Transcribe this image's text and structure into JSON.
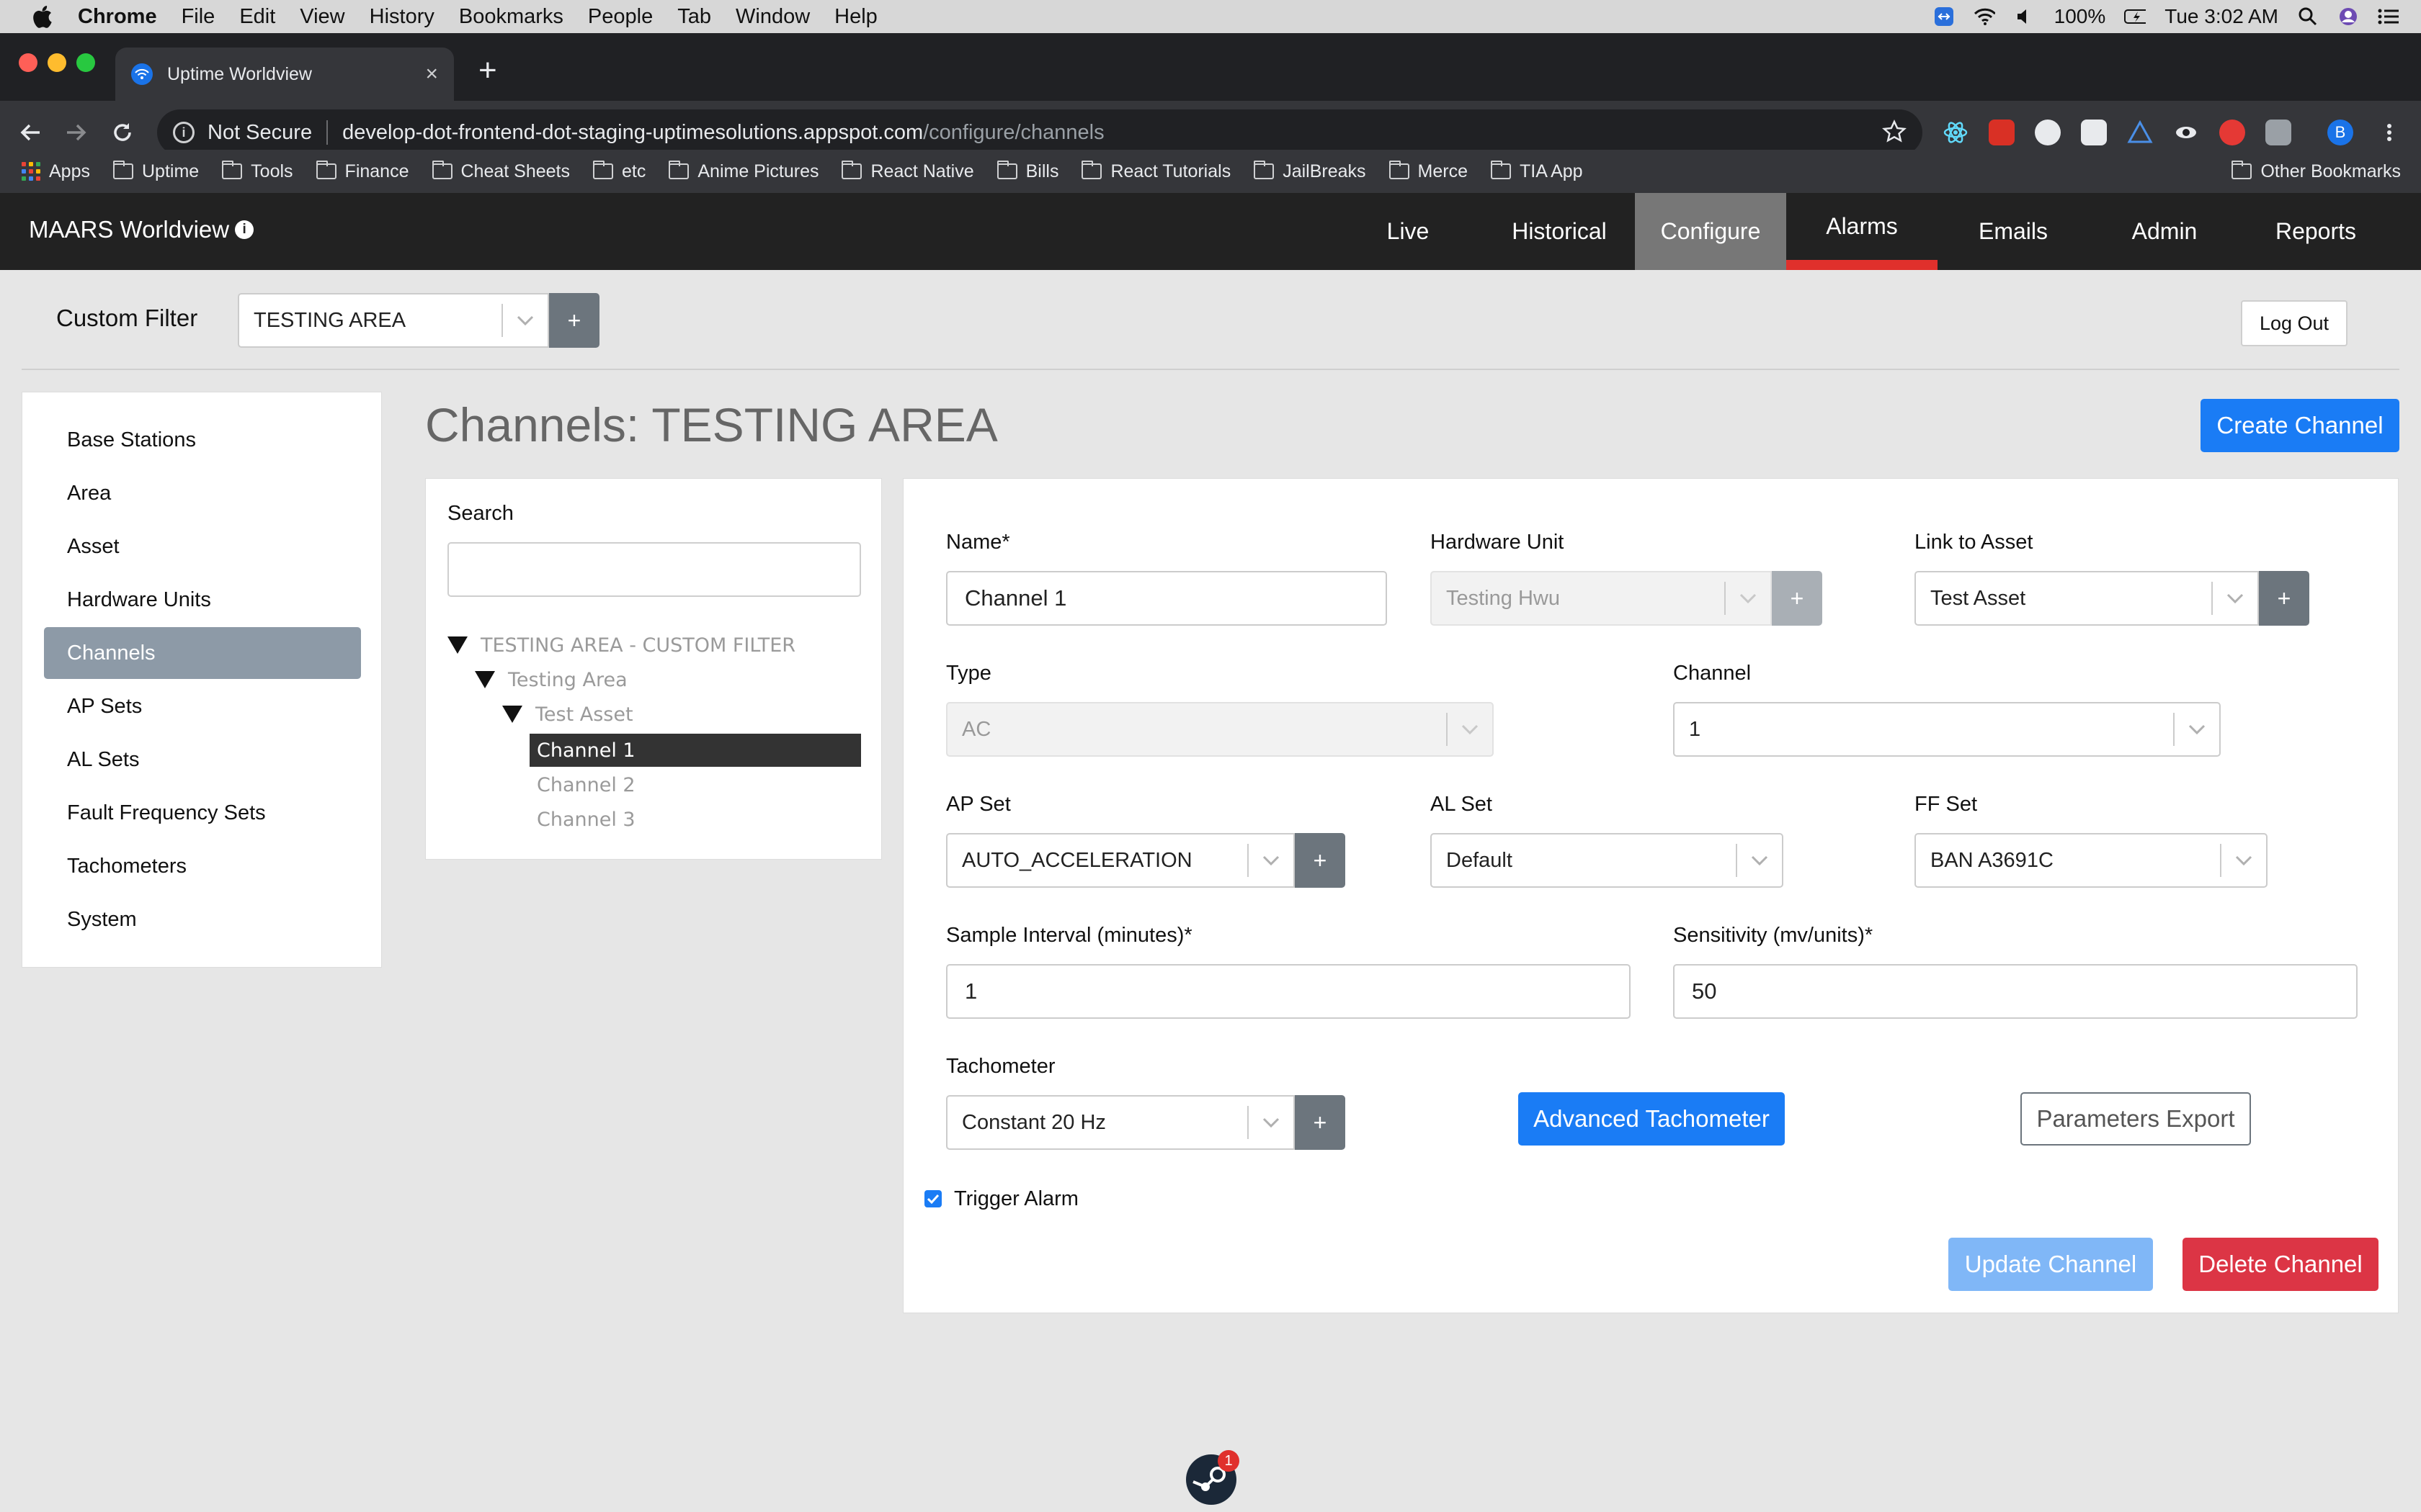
{
  "menubar": {
    "app": "Chrome",
    "items": [
      "File",
      "Edit",
      "View",
      "History",
      "Bookmarks",
      "People",
      "Tab",
      "Window",
      "Help"
    ],
    "battery": "100%",
    "clock": "Tue 3:02 AM"
  },
  "browser": {
    "tab_title": "Uptime Worldview",
    "security_label": "Not Secure",
    "url_host": "develop-dot-frontend-dot-staging-uptimesolutions.appspot.com",
    "url_path": "/configure/channels",
    "profile_initial": "B",
    "bookmarks": [
      "Apps",
      "Uptime",
      "Tools",
      "Finance",
      "Cheat Sheets",
      "etc",
      "Anime Pictures",
      "React Native",
      "Bills",
      "React Tutorials",
      "JailBreaks",
      "Merce",
      "TIA App"
    ],
    "other_bookmarks": "Other Bookmarks"
  },
  "app": {
    "brand": "MAARS Worldview",
    "nav": [
      "Live",
      "Historical",
      "Configure",
      "Alarms",
      "Emails",
      "Admin",
      "Reports"
    ],
    "active_nav": "Configure"
  },
  "filter": {
    "label": "Custom Filter",
    "value": "TESTING AREA",
    "add": "+",
    "logout": "Log Out"
  },
  "sidebar": {
    "items": [
      "Base Stations",
      "Area",
      "Asset",
      "Hardware Units",
      "Channels",
      "AP Sets",
      "AL Sets",
      "Fault Frequency Sets",
      "Tachometers",
      "System"
    ],
    "active": "Channels"
  },
  "page": {
    "title": "Channels: TESTING AREA",
    "create_button": "Create Channel"
  },
  "tree": {
    "search_label": "Search",
    "search_value": "",
    "root": "TESTING AREA - CUSTOM FILTER",
    "area": "Testing Area",
    "asset": "Test Asset",
    "channels": [
      "Channel 1",
      "Channel 2",
      "Channel 3"
    ],
    "selected": "Channel 1"
  },
  "form": {
    "name_label": "Name*",
    "name_value": "Channel 1",
    "hardware_label": "Hardware Unit",
    "hardware_value": "Testing Hwu",
    "asset_label": "Link to Asset",
    "asset_value": "Test Asset",
    "type_label": "Type",
    "type_value": "AC",
    "channel_label": "Channel",
    "channel_value": "1",
    "ap_label": "AP Set",
    "ap_value": "AUTO_ACCELERATION",
    "al_label": "AL Set",
    "al_value": "Default",
    "ff_label": "FF Set",
    "ff_value": "BAN A3691C",
    "interval_label": "Sample Interval (minutes)*",
    "interval_value": "1",
    "sensitivity_label": "Sensitivity (mv/units)*",
    "sensitivity_value": "50",
    "tach_label": "Tachometer",
    "tach_value": "Constant 20 Hz",
    "advanced_tach_button": "Advanced Tachometer",
    "params_export_button": "Parameters Export",
    "trigger_alarm_label": "Trigger Alarm",
    "trigger_alarm_checked": true,
    "update_button": "Update Channel",
    "delete_button": "Delete Channel",
    "plus": "+"
  },
  "dock": {
    "steam_badge": "1"
  },
  "colors": {
    "primary": "#1a7cf5",
    "danger": "#dc3545",
    "navbar": "#222222",
    "active_nav": "#777777",
    "alarm_underline": "#e0302c"
  }
}
